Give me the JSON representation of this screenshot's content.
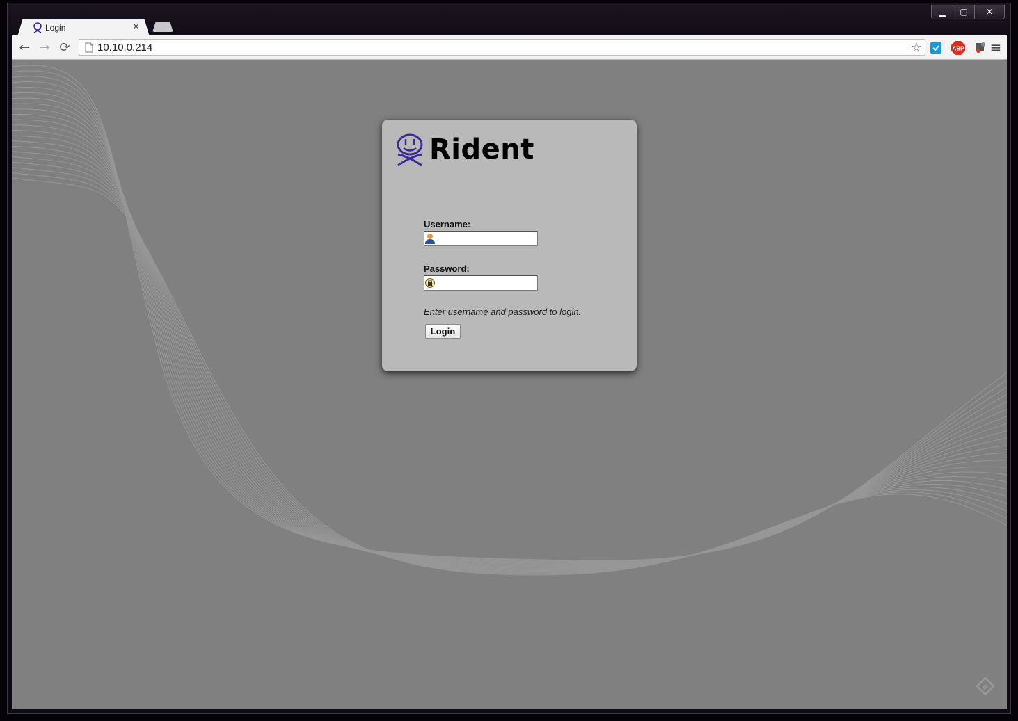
{
  "browser": {
    "tab_title": "Login",
    "tab_close": "×",
    "url": "10.10.0.214",
    "window_controls": {
      "minimize": "▁",
      "maximize": "▢",
      "close": "✕"
    },
    "nav": {
      "back": "←",
      "forward": "→",
      "reload": "⟳",
      "bookmark": "☆",
      "menu": "≡"
    },
    "extensions": {
      "adblock_label": "ABP"
    }
  },
  "login": {
    "brand": "Rident",
    "username_label": "Username:",
    "username_value": "",
    "password_label": "Password:",
    "password_value": "",
    "hint": "Enter username and password to login.",
    "submit_label": "Login"
  },
  "colors": {
    "page_background": "#808080",
    "panel_background": "#b9b9b9",
    "brand_icon": "#3a2a9a"
  }
}
